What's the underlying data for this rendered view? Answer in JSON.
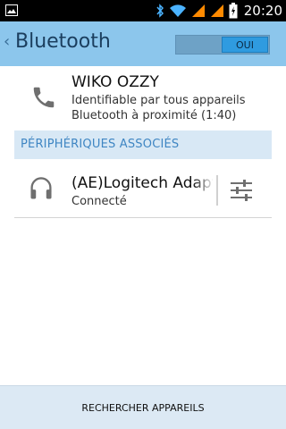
{
  "status_bar": {
    "time": "20:20",
    "icons": [
      "image-icon",
      "bluetooth-icon",
      "wifi-icon",
      "signal-icon",
      "signal-icon",
      "battery-charging-icon"
    ]
  },
  "action_bar": {
    "back_glyph": "‹",
    "title": "Bluetooth",
    "toggle_label": "OUI",
    "toggle_state": "on"
  },
  "device": {
    "icon": "phone-icon",
    "name": "WIKO OZZY",
    "line1": "Identifiable par tous appareils",
    "line2": "Bluetooth à proximité (1:40)"
  },
  "paired_section": {
    "header": "PÉRIPHÉRIQUES ASSOCIÉS",
    "items": [
      {
        "icon": "headphones-icon",
        "name": "(AE)Logitech Adapter",
        "status": "Connecté",
        "settings_icon": "settings-sliders-icon"
      }
    ]
  },
  "bottom": {
    "scan_label": "RECHERCHER APPAREILS"
  },
  "colors": {
    "action_bar": "#8cc6ec",
    "accent": "#2f9be0",
    "section_text": "#3f86c3",
    "section_bg": "#d8e8f5",
    "bottom_bar": "#dce9f4"
  }
}
